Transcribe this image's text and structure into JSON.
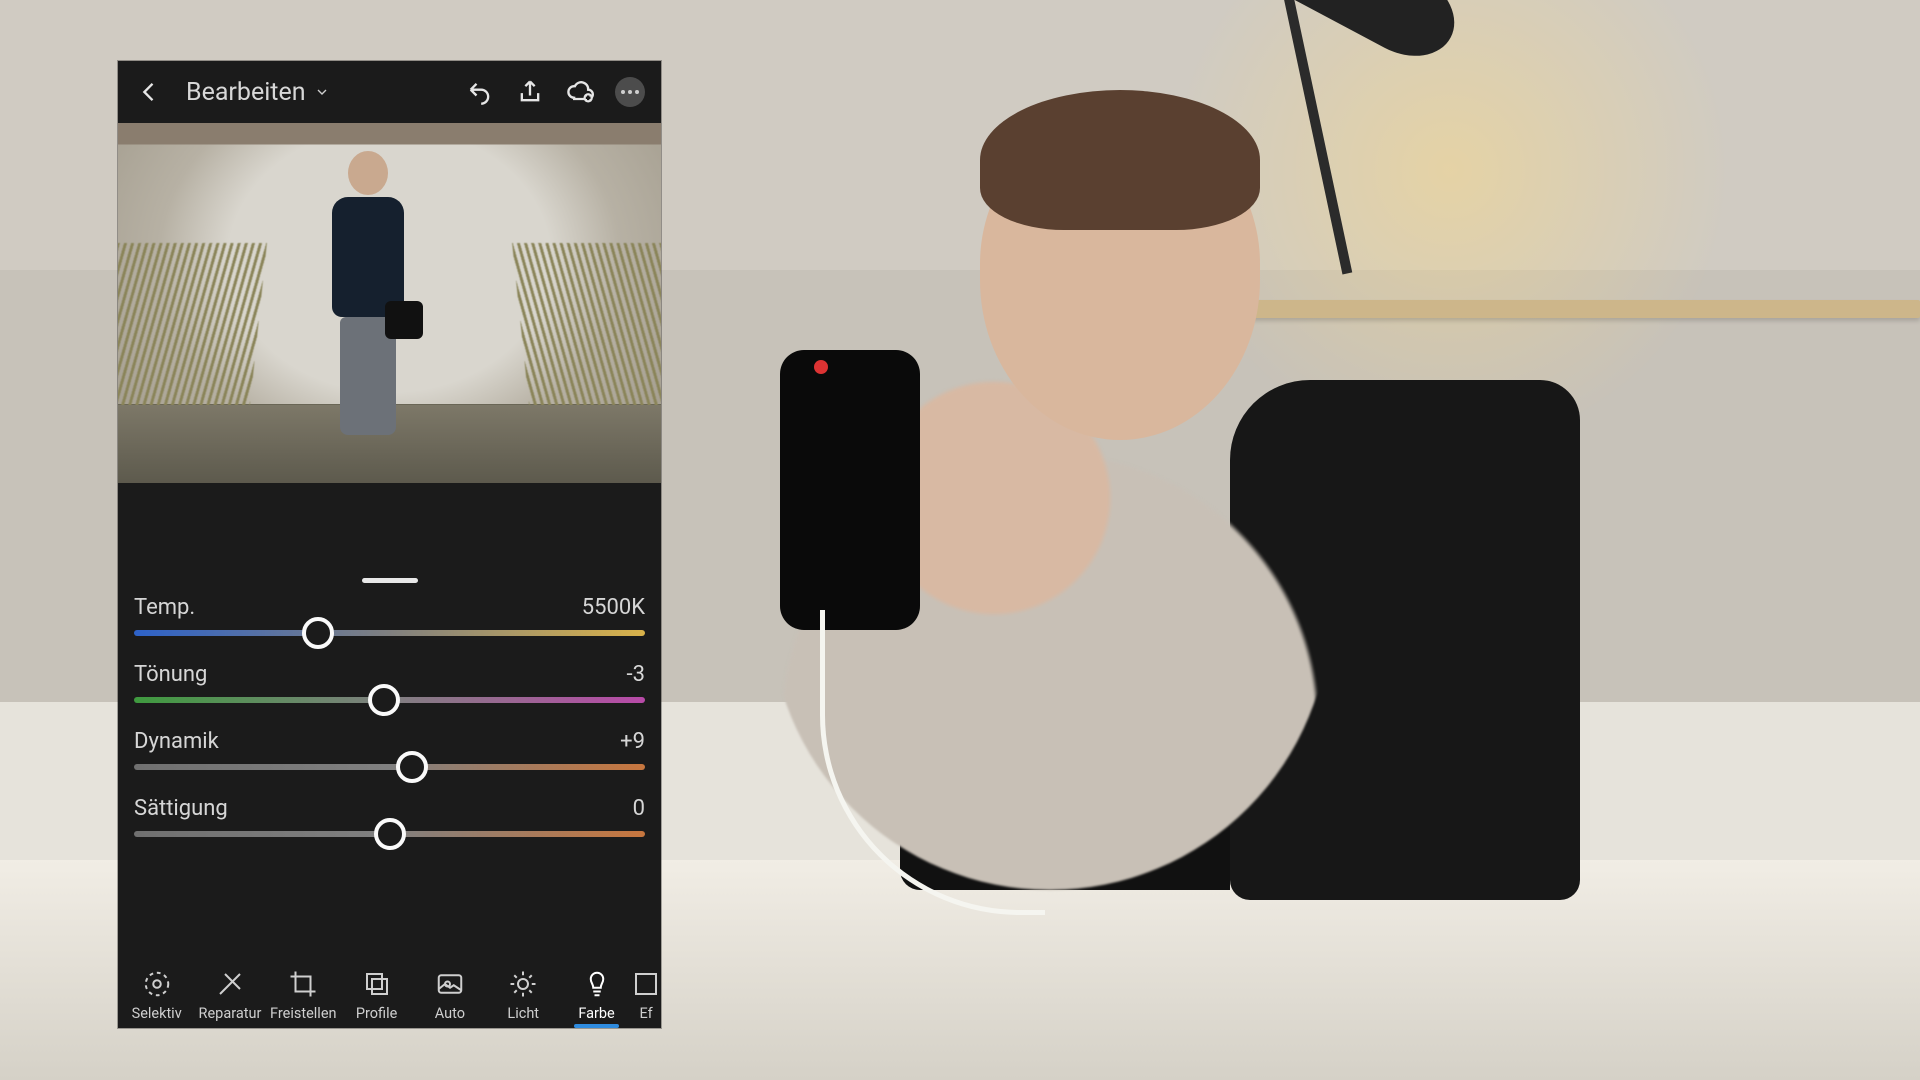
{
  "header": {
    "mode_label": "Bearbeiten"
  },
  "sliders": {
    "temp": {
      "label": "Temp.",
      "value": "5500K",
      "pos": 36
    },
    "tint": {
      "label": "Tönung",
      "value": "-3",
      "pos": 49
    },
    "vib": {
      "label": "Dynamik",
      "value": "+9",
      "pos": 54.5
    },
    "sat": {
      "label": "Sättigung",
      "value": "0",
      "pos": 50
    }
  },
  "tools": {
    "selektiv": "Selektiv",
    "reparatur": "Reparatur",
    "freistellen": "Freistellen",
    "profile": "Profile",
    "auto": "Auto",
    "licht": "Licht",
    "farbe": "Farbe",
    "effekte": "Ef"
  },
  "active_tool": "farbe"
}
